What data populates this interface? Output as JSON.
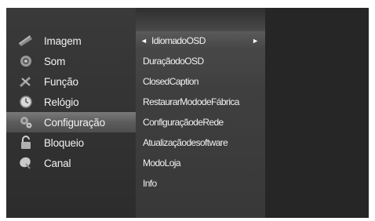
{
  "main_menu": {
    "items": [
      {
        "label": "Imagem",
        "icon": "picture-icon"
      },
      {
        "label": "Som",
        "icon": "speaker-icon"
      },
      {
        "label": "Função",
        "icon": "tools-icon"
      },
      {
        "label": "Relógio",
        "icon": "clock-icon"
      },
      {
        "label": "Configuração",
        "icon": "settings-icon",
        "selected": true
      },
      {
        "label": "Bloqueio",
        "icon": "lock-icon"
      },
      {
        "label": "Canal",
        "icon": "satellite-dish-icon"
      }
    ]
  },
  "submenu": {
    "left_arrow": "◄",
    "right_arrow": "►",
    "items": [
      {
        "label": "IdiomadoOSD",
        "selected": true
      },
      {
        "label": "DuraçãodoOSD"
      },
      {
        "label": "ClosedCaption"
      },
      {
        "label": "RestaurarMododeFábrica"
      },
      {
        "label": "ConfiguraçãodeRede"
      },
      {
        "label": "Atualizaçãodesoftware"
      },
      {
        "label": "ModoLoja"
      },
      {
        "label": "Info"
      }
    ]
  },
  "colors": {
    "screen_bg": "#1f1f1f",
    "selected_highlight": "#6a6a6a",
    "text": "#f2f2f2"
  }
}
